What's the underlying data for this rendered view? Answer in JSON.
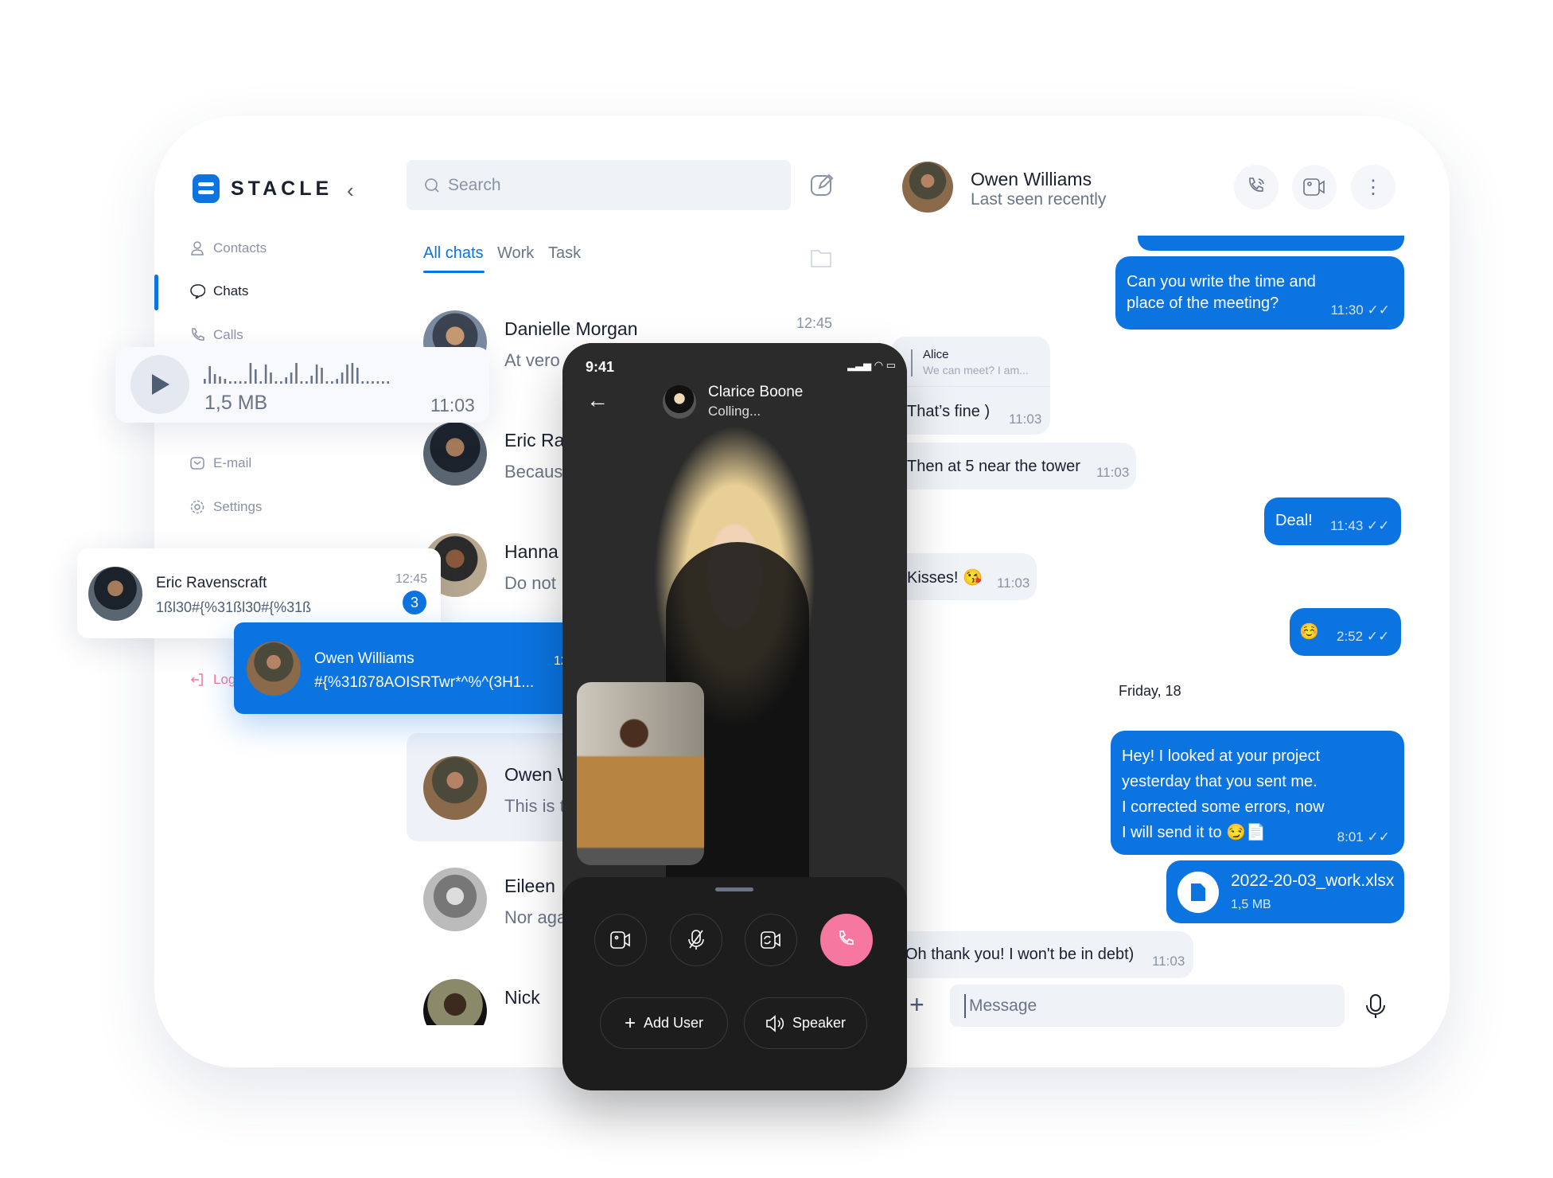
{
  "app": {
    "brand": "STACLE",
    "accent": "#0b74e0",
    "danger": "#f6779f"
  },
  "sidebar": {
    "items": [
      {
        "label": "Contacts",
        "icon": "user-icon"
      },
      {
        "label": "Chats",
        "icon": "chat-bubble-icon",
        "active": true
      },
      {
        "label": "Calls",
        "icon": "phone-icon"
      },
      {
        "label": "E-mail",
        "icon": "mail-icon"
      },
      {
        "label": "Settings",
        "icon": "gear-icon"
      },
      {
        "label": "Log",
        "icon": "logout-icon"
      }
    ]
  },
  "voice": {
    "size": "1,5 MB",
    "time": "11:03"
  },
  "search": {
    "placeholder": "Search"
  },
  "tabs": [
    {
      "label": "All chats",
      "active": true
    },
    {
      "label": "Work"
    },
    {
      "label": "Task"
    }
  ],
  "chats": [
    {
      "name": "Danielle Morgan",
      "preview": "At vero",
      "time": "12:45"
    },
    {
      "name": "Eric Ra",
      "preview": "Becaus"
    },
    {
      "name": "Hanna",
      "preview": "Do not"
    },
    {
      "name": "Owen W",
      "preview": "This is t"
    },
    {
      "name": "Eileen",
      "preview": "Nor aga"
    },
    {
      "name": "Nick",
      "preview": ""
    }
  ],
  "float_eric": {
    "name": "Eric Ravenscraft",
    "preview": "1ßl30#{%31ßl30#{%31ß",
    "time": "12:45",
    "badge": "3"
  },
  "float_owen": {
    "name": "Owen Williams",
    "preview": "#{%31ß78AOISRTwr*^%^(3H1...",
    "time": "12:45"
  },
  "call": {
    "status_time": "9:41",
    "caller": "Clarice Boone",
    "state": "Colling...",
    "add_user": "Add User",
    "speaker": "Speaker"
  },
  "conversation": {
    "name": "Owen Williams",
    "status": "Last seen recently",
    "messages": {
      "m1": {
        "text1": "Can you write the time and",
        "text2": "place of the meeting?",
        "time": "11:30"
      },
      "reply_name": "Alice",
      "reply_text": "We can meet? I am...",
      "m2": {
        "text": "That’s fine  )",
        "time": "11:03"
      },
      "m3": {
        "text": "Then at 5 near the tower",
        "time": "11:03"
      },
      "m4": {
        "text": "Deal!",
        "time": "11:43"
      },
      "m5": {
        "text": "Kisses! 😘",
        "time": "11:03"
      },
      "m6": {
        "text": "☺️",
        "time": "2:52"
      },
      "date": "Friday, 18",
      "m7": {
        "l1": "Hey! I looked at your project",
        "l2": "yesterday that you sent me.",
        "l3": "I corrected some errors, now",
        "l4": "I will send it to 😏📄",
        "time": "8:01"
      },
      "file": {
        "name": "2022-20-03_work.xlsx",
        "size": "1,5 MB"
      },
      "m8": {
        "text": "Oh thank you! I won't be in debt)",
        "time": "11:03"
      }
    },
    "input_placeholder": "Message"
  }
}
